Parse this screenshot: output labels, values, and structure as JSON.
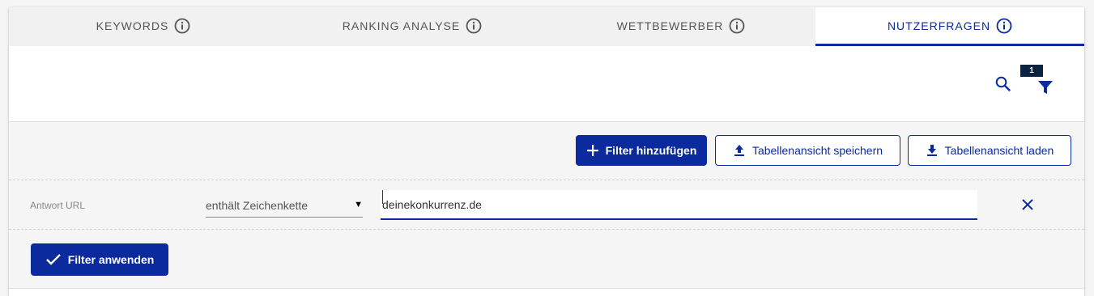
{
  "tabs": [
    {
      "label": "KEYWORDS",
      "active": false
    },
    {
      "label": "RANKING ANALYSE",
      "active": false
    },
    {
      "label": "WETTBEWERBER",
      "active": false
    },
    {
      "label": "NUTZERFRAGEN",
      "active": true
    }
  ],
  "toolbar": {
    "filter_badge": "1",
    "icons": [
      "search-icon",
      "filter-icon"
    ]
  },
  "actions": {
    "add_filter": "Filter hinzufügen",
    "save_view": "Tabellenansicht speichern",
    "load_view": "Tabellenansicht laden"
  },
  "filter": {
    "field_label": "Antwort URL",
    "operator": "enthält Zeichenkette",
    "value": "deinekonkurrenz.de"
  },
  "apply_button": "Filter anwenden",
  "colors": {
    "accent": "#0a2a9e",
    "badge": "#0c2340",
    "panel_bg": "#f5f5f5"
  }
}
